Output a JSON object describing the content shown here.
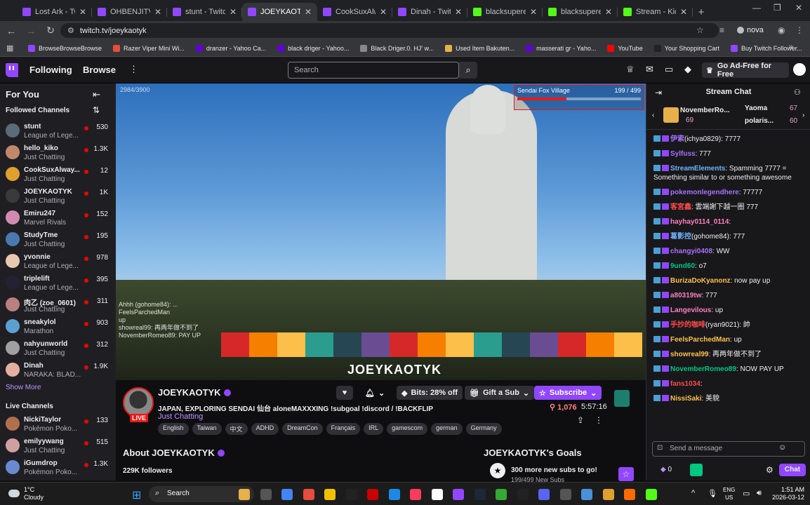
{
  "browser": {
    "tabs": [
      {
        "title": "Lost Ark - Twitch",
        "color": "#9147ff"
      },
      {
        "title": "OHBENJITV - Tw",
        "color": "#9147ff"
      },
      {
        "title": "stunt - Twitc",
        "color": "#9147ff"
      },
      {
        "title": "JOEYKAOTY",
        "color": "#9147ff",
        "active": true
      },
      {
        "title": "CookSuxAlw",
        "color": "#9147ff"
      },
      {
        "title": "Dinah - Twit",
        "color": "#9147ff"
      },
      {
        "title": "blacksupered St",
        "color": "#53fc18"
      },
      {
        "title": "blacksupered St",
        "color": "#53fc18"
      },
      {
        "title": "Stream - Kick D",
        "color": "#53fc18"
      }
    ],
    "url": "twitch.tv/joeykaotyk",
    "profile": "nova",
    "bookmarks": [
      "BrowseBrowseBrowse",
      "Razer Viper Mini Wi...",
      "dranzer - Yahoo Ca...",
      "black driger - Yahoo...",
      "Black Driger.0. HJ' w...",
      "Used Item Bakuten...",
      "masserati gr - Yaho...",
      "YouTube",
      "Your Shopping Cart",
      "Buy Twitch Follower..."
    ]
  },
  "twitch": {
    "nav": {
      "following": "Following",
      "browse": "Browse",
      "search_placeholder": "Search",
      "ad_free": "Go Ad-Free for Free"
    },
    "sidebar": {
      "for_you": "For You",
      "followed_header": "Followed Channels",
      "followed": [
        {
          "name": "stunt",
          "game": "League of Lege...",
          "viewers": "530",
          "color": "#5a6b7a"
        },
        {
          "name": "hello_kiko",
          "game": "Just Chatting",
          "viewers": "1.3K",
          "color": "#c08a6a"
        },
        {
          "name": "CookSuxAlway...",
          "game": "Just Chatting",
          "viewers": "12",
          "color": "#e0a030"
        },
        {
          "name": "JOEYKAOTYK",
          "game": "Just Chatting",
          "viewers": "1K",
          "color": "#3a3a3a"
        },
        {
          "name": "Emiru247",
          "game": "Marvel Rivals",
          "viewers": "152",
          "color": "#d08bb0"
        },
        {
          "name": "StudyTme",
          "game": "Just Chatting",
          "viewers": "195",
          "color": "#4a78b0"
        },
        {
          "name": "yvonnie",
          "game": "League of Lege...",
          "viewers": "978",
          "color": "#e8c8b0"
        },
        {
          "name": "triplelift",
          "game": "League of Lege...",
          "viewers": "395",
          "color": "#223"
        },
        {
          "name": "肉乙 (zoe_0601)",
          "game": "Just Chatting",
          "viewers": "311",
          "color": "#b98080"
        },
        {
          "name": "sneakylol",
          "game": "Marathon",
          "viewers": "903",
          "color": "#5ca0d0"
        },
        {
          "name": "nahyunworld",
          "game": "Just Chatting",
          "viewers": "312",
          "color": "#a0a0a0"
        },
        {
          "name": "Dinah",
          "game": "NARAKA: BLAD...",
          "viewers": "1.9K",
          "color": "#e3b0a0"
        }
      ],
      "show_more": "Show More",
      "live_header": "Live Channels",
      "live": [
        {
          "name": "NickiTaylor",
          "game": "Pokémon Poko...",
          "viewers": "133",
          "color": "#b07050"
        },
        {
          "name": "emilyywang",
          "game": "Just Chatting",
          "viewers": "515",
          "color": "#d0a0a0"
        },
        {
          "name": "iGumdrop",
          "game": "Pokémon Poko...",
          "viewers": "1.3K",
          "color": "#6a8ad0"
        }
      ]
    },
    "video": {
      "counter": "2984/3900",
      "goal_label": "Sendai Fox Village",
      "goal_count": "199 / 499",
      "goal_progress": 0.4,
      "watermark": "JOEYKAOTYK",
      "overlay_chat": [
        "Ahhh (gohome84): ...",
        "FeelsParchedMan",
        "up",
        "showreal99: 再两年做不到了",
        "NovemberRomeo89: PAY UP"
      ]
    },
    "stream": {
      "name": "JOEYKAOTYK",
      "live": "LIVE",
      "title": "JAPAN, EXPLORING SENDAI 仙台 aloneMAXXXING !subgoal !discord / !BACKFLIP",
      "category": "Just Chatting",
      "tags": [
        "English",
        "Taiwan",
        "中文",
        "ADHD",
        "DreamCon",
        "Français",
        "IRL",
        "gamescom",
        "german",
        "Germany"
      ],
      "bits": "Bits: 28% off",
      "gift": "Gift a Sub",
      "subscribe": "Subscribe",
      "viewers": "1,076",
      "uptime": "5:57:16",
      "about": "About JOEYKAOTYK",
      "followers": "229K followers",
      "goals_title": "JOEYKAOTYK's Goals",
      "goal_text": "300 more new subs to go!",
      "goal_sub": "199/499 New Subs"
    },
    "chat": {
      "title": "Stream Chat",
      "leaderboard": [
        {
          "name": "NovemberRo...",
          "score": "69"
        },
        {
          "name": "Yaoma",
          "score": "67"
        },
        {
          "name": "polaris...",
          "score": "60"
        }
      ],
      "messages": [
        {
          "user": "伊索",
          "color": "#a970ff",
          "text": "(ichya0829): 7777"
        },
        {
          "user": "Sylfuss",
          "color": "#a970ff",
          "text": ": 777"
        },
        {
          "user": "StreamElements",
          "color": "#6fb4ff",
          "text": ": Spamming 7777 = Something similar to or something awesome"
        },
        {
          "user": "pokemonlegendhere",
          "color": "#a970ff",
          "text": ": 77777"
        },
        {
          "user": "客宮鑫",
          "color": "#ff4a4a",
          "text": ": 雲端謝下越一圈 777"
        },
        {
          "user": "hayhay0114_0114",
          "color": "#ff7fbf",
          "text": ":"
        },
        {
          "user": "葛影控",
          "color": "#6fb4ff",
          "text": "(gohome84): 777"
        },
        {
          "user": "changyi0408",
          "color": "#a970ff",
          "text": ": WW"
        },
        {
          "user": "9und60",
          "color": "#00c77f",
          "text": ": o7"
        },
        {
          "user": "BurizaDoKyanonz",
          "color": "#ffc04a",
          "text": ": now pay up"
        },
        {
          "user": "a80319tw",
          "color": "#ff7fbf",
          "text": ": 777"
        },
        {
          "user": "Langevilous",
          "color": "#ff7fbf",
          "text": ": up"
        },
        {
          "user": "手抄的咖啡",
          "color": "#ff4a4a",
          "text": "(ryan9021): 帥"
        },
        {
          "user": "FeelsParchedMan",
          "color": "#ffc04a",
          "text": ": up"
        },
        {
          "user": "showreal99",
          "color": "#ffc04a",
          "text": ": 再两年做不到了"
        },
        {
          "user": "NovemberRomeo89",
          "color": "#00c77f",
          "text": ": NOW PAY UP"
        },
        {
          "user": "fans1034",
          "color": "#ff4a4a",
          "text": ":"
        },
        {
          "user": "NissiSaki",
          "color": "#ffc04a",
          "text": ": 美貌"
        }
      ],
      "placeholder": "Send a message",
      "points": "0",
      "chat_button": "Chat"
    }
  },
  "taskbar": {
    "temp": "1°C",
    "weather": "Cloudy",
    "search": "Search",
    "lang1": "ENG",
    "lang2": "US",
    "time": "1:51 AM",
    "date": "2026-03-12"
  }
}
